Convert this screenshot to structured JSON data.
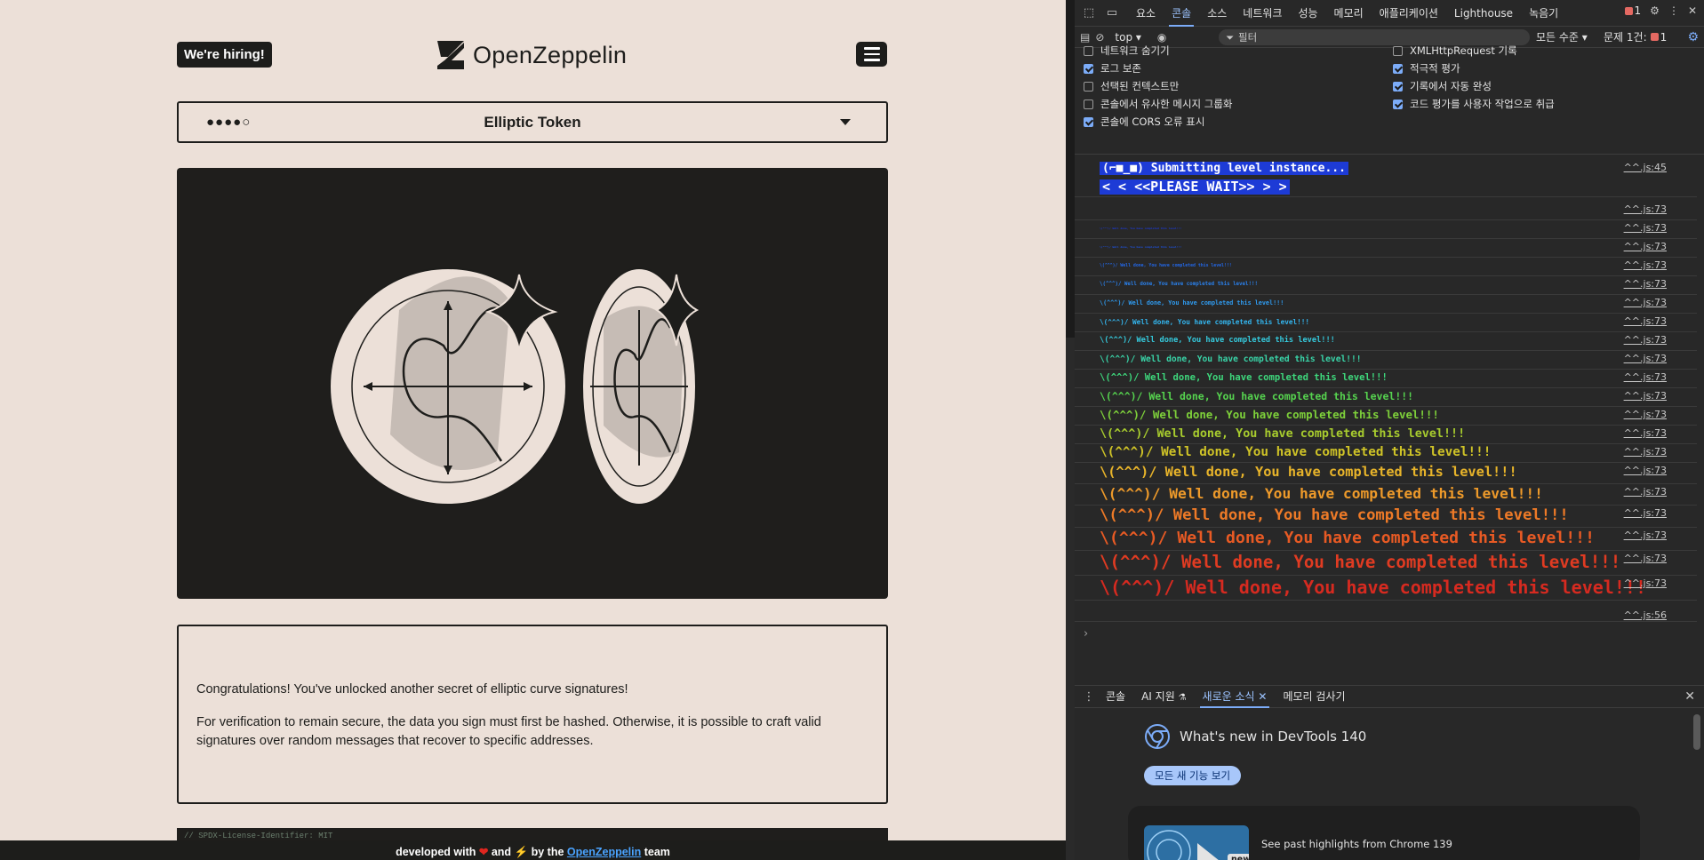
{
  "page": {
    "hiring_label": "We're hiring!",
    "logo_text": "OpenZeppelin",
    "level": {
      "difficulty_dots": "●●●●○",
      "title": "Elliptic Token"
    },
    "description": {
      "paragraph1": "Congratulations! You've unlocked another secret of elliptic curve signatures!",
      "paragraph2": "For verification to remain secure, the data you sign must first be hashed. Otherwise, it is possible to craft valid signatures over random messages that recover to specific addresses."
    },
    "code_snippet": "// SPDX-License-Identifier: MIT",
    "footer": {
      "prefix": "developed with",
      "heart": "❤",
      "and": "and",
      "bolt": "⚡",
      "by_the": "by the",
      "link": "OpenZeppelin",
      "suffix": "team"
    }
  },
  "devtools": {
    "tabs": [
      "요소",
      "콘솔",
      "소스",
      "네트워크",
      "성능",
      "메모리",
      "애플리케이션",
      "Lighthouse",
      "녹음기"
    ],
    "active_tab": "콘솔",
    "error_count": "1",
    "toolbar": {
      "context": "top",
      "filter_placeholder": "필터",
      "levels": "모든 수준",
      "issues_label": "문제 1건:",
      "issues_count": "1"
    },
    "options": [
      {
        "label": "네트워크 숨기기",
        "checked": false
      },
      {
        "label": "로그 보존",
        "checked": true
      },
      {
        "label": "선택된 컨텍스트만",
        "checked": false
      },
      {
        "label": "콘솔에서 유사한 메시지 그룹화",
        "checked": false
      },
      {
        "label": "콘솔에 CORS 오류 표시",
        "checked": true
      },
      {
        "label": "XMLHttpRequest 기록",
        "checked": false
      },
      {
        "label": "적극적 평가",
        "checked": true
      },
      {
        "label": "기록에서 자동 완성",
        "checked": true
      },
      {
        "label": "코드 평가를 사용자 작업으로 취급",
        "checked": true
      }
    ],
    "log": {
      "submitting": "(⌐■_■) Submitting level instance...",
      "please_wait": "<  < <<PLEASE WAIT>> >  >",
      "src_45": "^^.js:45",
      "src_73": "^^.js:73",
      "src_56": "^^.js:56",
      "well_done": "\\(^^^)/ Well done, You have completed this level!!!",
      "colors": [
        "#1d3bd6",
        "#1d3bd6",
        "#1f52e0",
        "#2367e6",
        "#2a80ec",
        "#2f9bf0",
        "#33b5ee",
        "#35c9dc",
        "#39d4a8",
        "#3ed77c",
        "#56d44f",
        "#7ed13a",
        "#a8cc2e",
        "#cfc327",
        "#e8b42a",
        "#ee9a2a",
        "#ee7a27",
        "#e85a24",
        "#e03b22",
        "#d62a20"
      ]
    },
    "drawer": {
      "tabs": [
        "콘솔",
        "AI 지원",
        "새로운 소식",
        "메모리 검사기"
      ],
      "active_tab": "새로운 소식",
      "whats_new_title": "What's new in DevTools 140",
      "see_all_button": "모든 새 기능 보기",
      "card_badge": "new",
      "card_text": "See past highlights from Chrome 139"
    }
  }
}
